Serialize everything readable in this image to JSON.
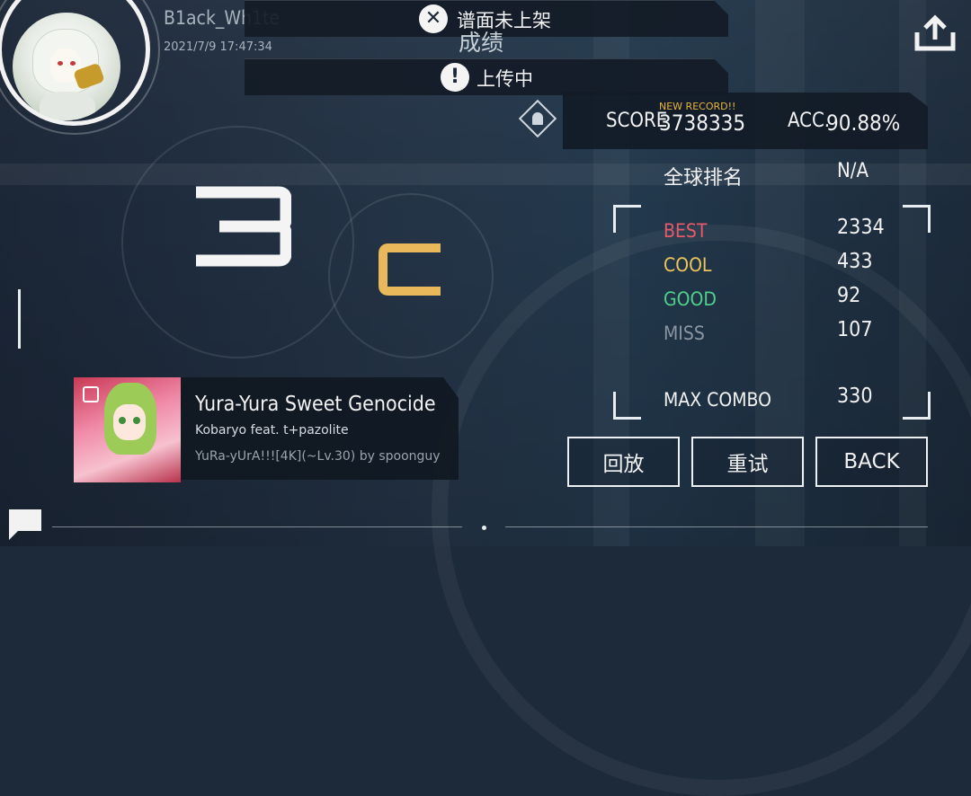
{
  "header": {
    "username": "B1ack_Wh1te",
    "datetime": "2021/7/9 17:47:34",
    "section_title": "成绩"
  },
  "toasts": [
    {
      "icon": "close-circle-icon",
      "glyph": "✕",
      "text": "谱面未上架"
    },
    {
      "icon": "alert-circle-icon",
      "glyph": "!",
      "text": "上传中"
    }
  ],
  "score": {
    "new_record_label": "NEW RECORD!!",
    "score_label": "SCORE",
    "score_value": "3738335",
    "acc_label": "ACC.",
    "acc_value": "90.88%"
  },
  "ranks": {
    "left_rank": "3",
    "grade": "C"
  },
  "global_rank": {
    "label": "全球排名",
    "value": "N/A"
  },
  "stats": [
    {
      "label": "BEST",
      "value": "2334",
      "color": "#e8596a"
    },
    {
      "label": "COOL",
      "value": "433",
      "color": "#f0c45a"
    },
    {
      "label": "GOOD",
      "value": "92",
      "color": "#4fd08a"
    },
    {
      "label": "MISS",
      "value": "107",
      "color": "#8b96a2"
    }
  ],
  "max_combo": {
    "label": "MAX COMBO",
    "value": "330"
  },
  "song": {
    "title": "Yura-Yura Sweet Genocide",
    "artist": "Kobaryo feat. t+pazolite",
    "chart_info": "YuRa-yUrA!!![4K](~Lv.30) by spoonguy"
  },
  "buttons": {
    "replay": "回放",
    "retry": "重试",
    "back": "BACK"
  },
  "colors": {
    "accent_gold": "#e9b53a",
    "grade_c": "#e8b85a"
  }
}
